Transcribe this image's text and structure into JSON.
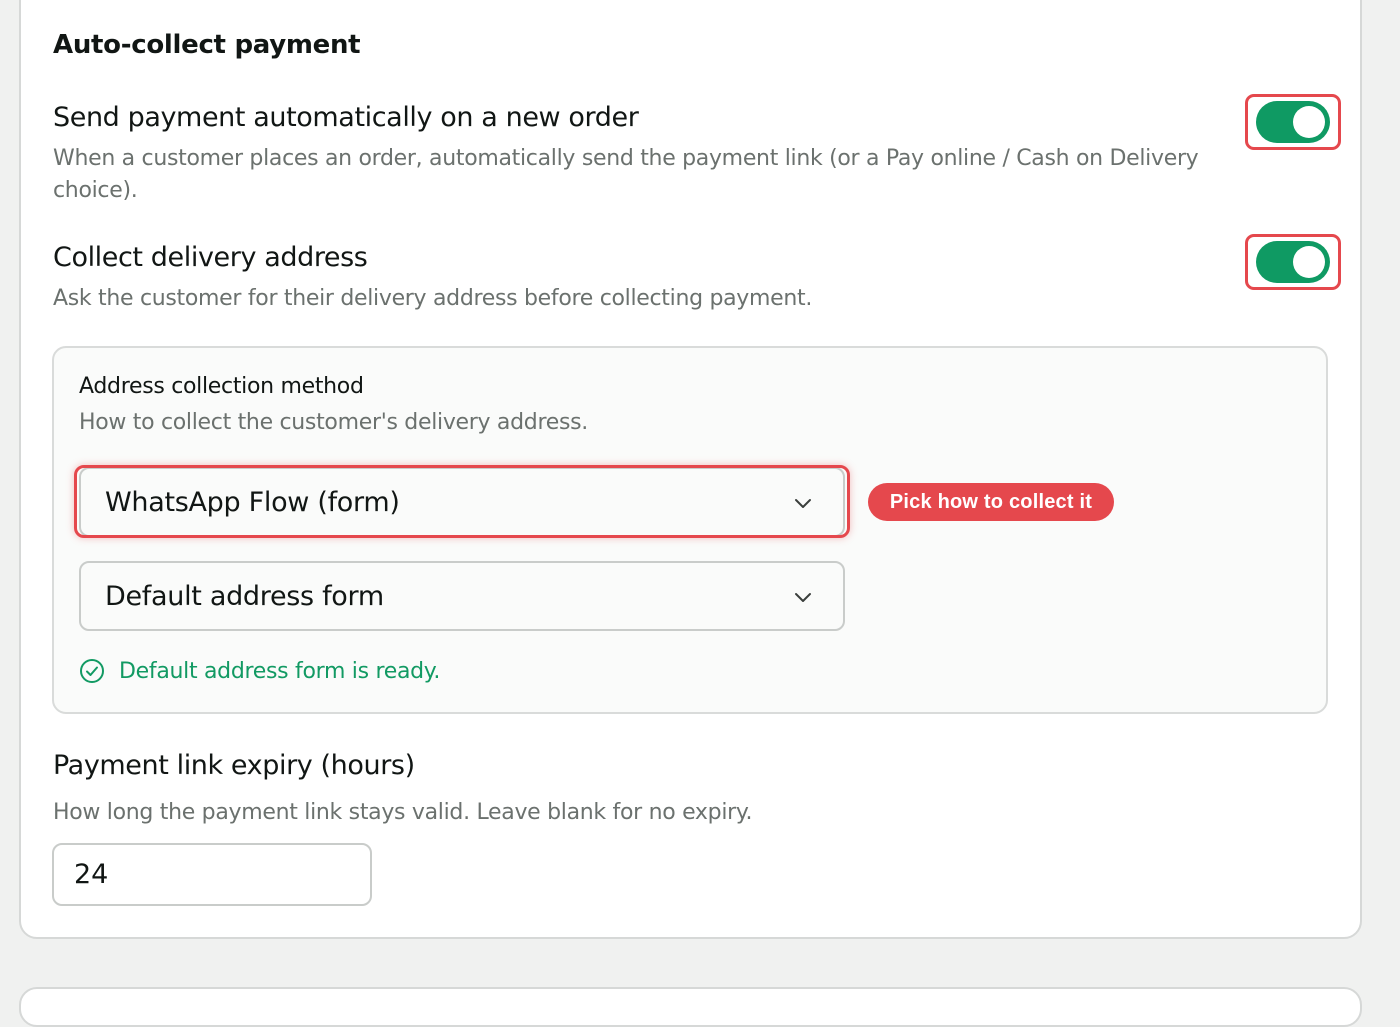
{
  "section": {
    "title": "Auto-collect payment"
  },
  "send_payment": {
    "title": "Send payment automatically on a new order",
    "description": "When a customer places an order, automatically send the payment link (or a Pay online / Cash on Delivery choice).",
    "enabled": true
  },
  "collect_address": {
    "title": "Collect delivery address",
    "description": "Ask the customer for their delivery address before collecting payment.",
    "enabled": true
  },
  "address_method": {
    "label": "Address collection method",
    "description": "How to collect the customer's delivery address.",
    "method_selected": "WhatsApp Flow (form)",
    "form_selected": "Default address form",
    "hint_badge": "Pick how to collect it",
    "status_text": "Default address form is ready."
  },
  "expiry": {
    "title": "Payment link expiry (hours)",
    "description": "How long the payment link stays valid. Leave blank for no expiry.",
    "value": "24"
  },
  "colors": {
    "toggle_on": "#0f9a63",
    "highlight": "#e5484d",
    "success": "#129a63"
  },
  "icons": {
    "select_caret": "chevron-down-icon",
    "status": "check-circle-icon"
  }
}
